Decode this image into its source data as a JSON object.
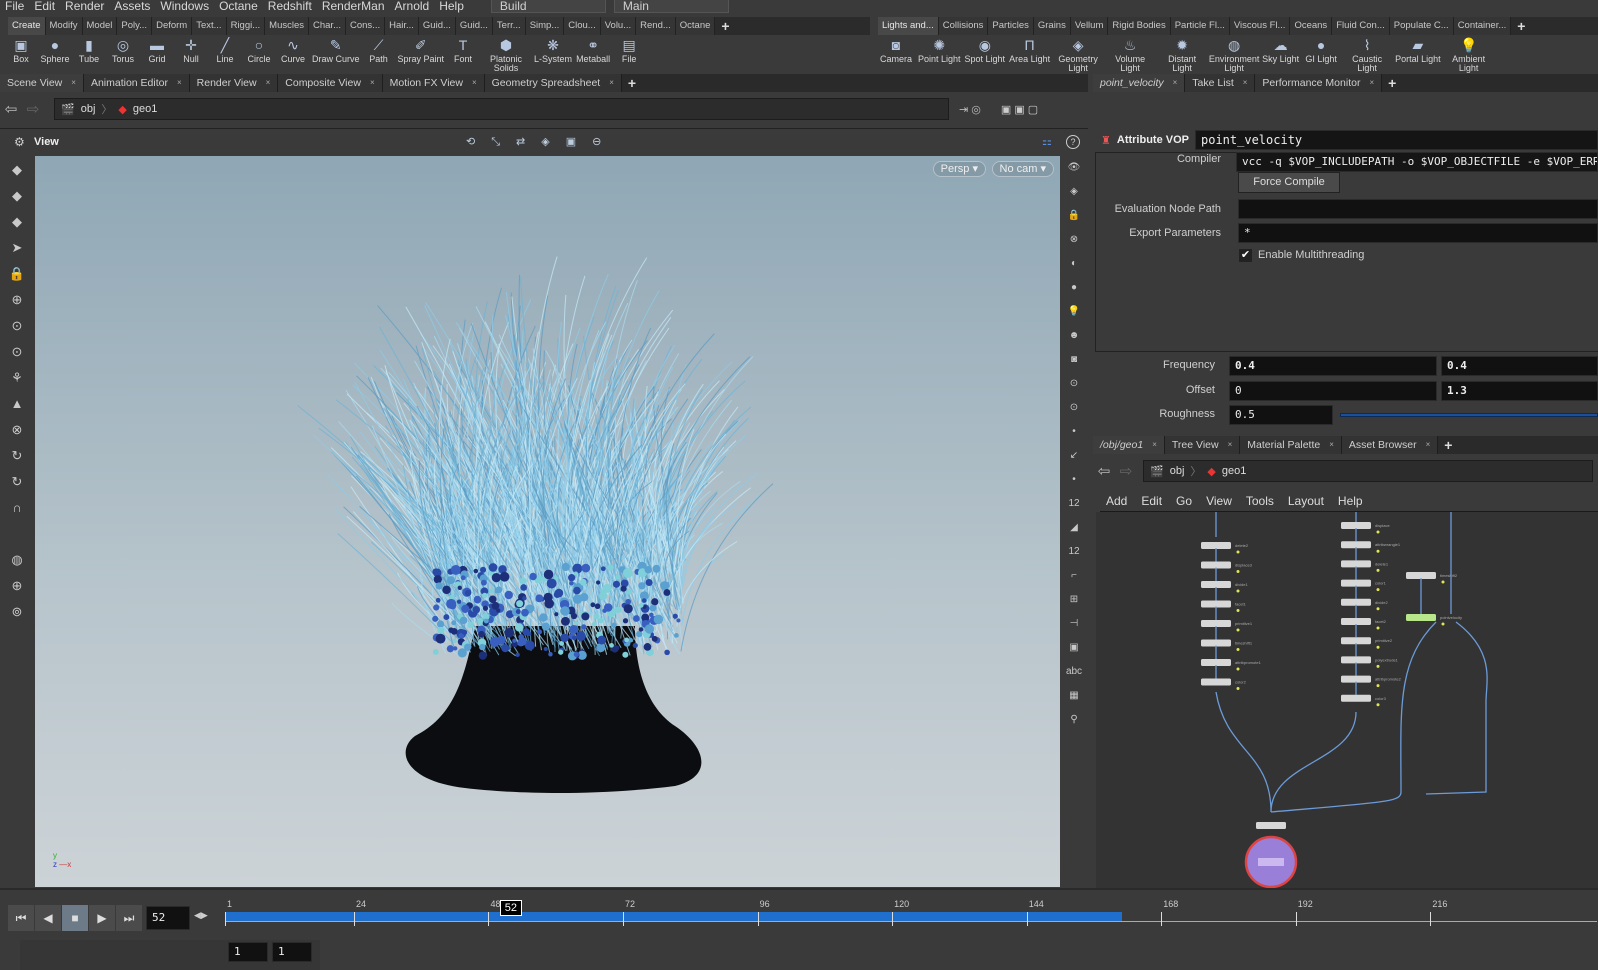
{
  "menu": [
    "File",
    "Edit",
    "Render",
    "Assets",
    "Windows",
    "Octane",
    "Redshift",
    "RenderMan",
    "Arnold",
    "Help"
  ],
  "desktop": {
    "build": "Build",
    "main": "Main"
  },
  "shelf_tabs_left": [
    "Create",
    "Modify",
    "Model",
    "Poly...",
    "Deform",
    "Text...",
    "Riggi...",
    "Muscles",
    "Char...",
    "Cons...",
    "Hair...",
    "Guid...",
    "Guid...",
    "Terr...",
    "Simp...",
    "Clou...",
    "Volu...",
    "Rend...",
    "Octane"
  ],
  "shelf_tools_left": [
    {
      "label": "Box",
      "icon": "box-icon",
      "g": "▣"
    },
    {
      "label": "Sphere",
      "icon": "sphere-icon",
      "g": "●"
    },
    {
      "label": "Tube",
      "icon": "tube-icon",
      "g": "▮"
    },
    {
      "label": "Torus",
      "icon": "torus-icon",
      "g": "◎"
    },
    {
      "label": "Grid",
      "icon": "grid-icon",
      "g": "▬"
    },
    {
      "label": "Null",
      "icon": "null-icon",
      "g": "✛"
    },
    {
      "label": "Line",
      "icon": "line-icon",
      "g": "╱"
    },
    {
      "label": "Circle",
      "icon": "circle-icon",
      "g": "○"
    },
    {
      "label": "Curve",
      "icon": "curve-icon",
      "g": "∿"
    },
    {
      "label": "Draw Curve",
      "icon": "draw-curve-icon",
      "g": "✎"
    },
    {
      "label": "Path",
      "icon": "path-icon",
      "g": "⟋"
    },
    {
      "label": "Spray Paint",
      "icon": "spray-paint-icon",
      "g": "✐"
    },
    {
      "label": "Font",
      "icon": "font-icon",
      "g": "T"
    },
    {
      "label": "Platonic Solids",
      "icon": "platonic-icon",
      "g": "⬢"
    },
    {
      "label": "L-System",
      "icon": "lsystem-icon",
      "g": "❋"
    },
    {
      "label": "Metaball",
      "icon": "metaball-icon",
      "g": "⚭"
    },
    {
      "label": "File",
      "icon": "file-icon",
      "g": "▤"
    }
  ],
  "shelf_tabs_right": [
    "Lights and...",
    "Collisions",
    "Particles",
    "Grains",
    "Vellum",
    "Rigid Bodies",
    "Particle Fl...",
    "Viscous Fl...",
    "Oceans",
    "Fluid Con...",
    "Populate C...",
    "Container..."
  ],
  "shelf_tools_right": [
    {
      "label": "Camera",
      "icon": "camera-icon",
      "g": "◙"
    },
    {
      "label": "Point Light",
      "icon": "point-light-icon",
      "g": "✺"
    },
    {
      "label": "Spot Light",
      "icon": "spot-light-icon",
      "g": "◉"
    },
    {
      "label": "Area Light",
      "icon": "area-light-icon",
      "g": "Π"
    },
    {
      "label": "Geometry Light",
      "icon": "geometry-light-icon",
      "g": "◈"
    },
    {
      "label": "Volume Light",
      "icon": "volume-light-icon",
      "g": "♨"
    },
    {
      "label": "Distant Light",
      "icon": "distant-light-icon",
      "g": "✹"
    },
    {
      "label": "Environment Light",
      "icon": "environment-light-icon",
      "g": "◍"
    },
    {
      "label": "Sky Light",
      "icon": "sky-light-icon",
      "g": "☁"
    },
    {
      "label": "GI Light",
      "icon": "gi-light-icon",
      "g": "●"
    },
    {
      "label": "Caustic Light",
      "icon": "caustic-light-icon",
      "g": "⌇"
    },
    {
      "label": "Portal Light",
      "icon": "portal-light-icon",
      "g": "▰"
    },
    {
      "label": "Ambient Light",
      "icon": "ambient-light-icon",
      "g": "💡"
    }
  ],
  "left_tabs": [
    "Scene View",
    "Animation Editor",
    "Render View",
    "Composite View",
    "Motion FX View",
    "Geometry Spreadsheet"
  ],
  "right_tabs": [
    "point_velocity",
    "Take List",
    "Performance Monitor"
  ],
  "path": {
    "obj": "obj",
    "geo": "geo1"
  },
  "viewer": {
    "title": "View",
    "persp": "Persp",
    "cam": "No cam"
  },
  "params": {
    "type": "Attribute VOP",
    "name": "point_velocity",
    "compiler_label": "Compiler",
    "compiler": "vcc -q $VOP_INCLUDEPATH -o $VOP_OBJECTFILE -e $VOP_ERRORFILE",
    "force_compile": "Force Compile",
    "eval_label": "Evaluation Node Path",
    "eval": "",
    "export_label": "Export Parameters",
    "export": "*",
    "multithread": "Enable Multithreading",
    "multithread_on": true,
    "freq_label": "Frequency",
    "freq": [
      "0.4",
      "0.4"
    ],
    "offset_label": "Offset",
    "offset": [
      "0",
      "1.3"
    ],
    "rough_label": "Roughness",
    "rough": "0.5"
  },
  "net_tabs": [
    "/obj/geo1",
    "Tree View",
    "Material Palette",
    "Asset Browser"
  ],
  "net_menu": [
    "Add",
    "Edit",
    "Go",
    "View",
    "Tools",
    "Layout",
    "Help"
  ],
  "nodes_a": [
    "delete2",
    "displace3",
    "divide1",
    "facet1",
    "primitive1",
    "timeshift1",
    "attribpromote1",
    "color2"
  ],
  "nodes_b": [
    "displace",
    "attribwrangle1",
    "delete1",
    "color1",
    "divide2",
    "facet2",
    "primitive2",
    "polyextrude1",
    "attribpromote2",
    "color3"
  ],
  "nodes_c": [
    "timeshift2",
    "pointvelocity",
    "color4",
    "merge1",
    "color5",
    "null1",
    "transform1",
    "color6",
    "merge2",
    "OUT"
  ],
  "timeline": {
    "frame": "52",
    "ticks": [
      "1",
      "24",
      "48",
      "72",
      "96",
      "120",
      "144",
      "168",
      "192",
      "216"
    ],
    "start": 1,
    "cached_end": 161,
    "range_start": "1",
    "range_end": "1"
  },
  "colors": {
    "accent": "#1f6fcf",
    "bg": "#3a3a3a"
  }
}
